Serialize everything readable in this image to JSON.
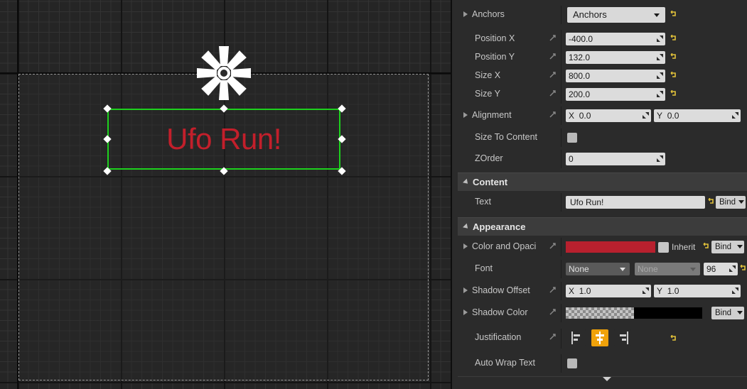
{
  "canvas": {
    "widget_text": "Ufo Run!",
    "widget_text_color": "#c31f2b",
    "selection_color": "#1dd11d"
  },
  "details": {
    "anchors": {
      "label": "Anchors",
      "value": "Anchors"
    },
    "position_x": {
      "label": "Position X",
      "value": "-400.0"
    },
    "position_y": {
      "label": "Position Y",
      "value": "132.0"
    },
    "size_x": {
      "label": "Size X",
      "value": "800.0"
    },
    "size_y": {
      "label": "Size Y",
      "value": "200.0"
    },
    "alignment": {
      "label": "Alignment",
      "x_label": "X",
      "x_value": "0.0",
      "y_label": "Y",
      "y_value": "0.0"
    },
    "size_to_content": {
      "label": "Size To Content"
    },
    "zorder": {
      "label": "ZOrder",
      "value": "0"
    },
    "content_section": {
      "title": "Content"
    },
    "text": {
      "label": "Text",
      "value": "Ufo Run!",
      "bind_label": "Bind"
    },
    "appearance_section": {
      "title": "Appearance"
    },
    "color_opacity": {
      "label": "Color and Opaci",
      "inherit_label": "Inherit",
      "bind_label": "Bind",
      "color": "#b8202e"
    },
    "font": {
      "label": "Font",
      "family": "None",
      "typeface": "None",
      "size": "96"
    },
    "shadow_offset": {
      "label": "Shadow Offset",
      "x_label": "X",
      "x_value": "1.0",
      "y_label": "Y",
      "y_value": "1.0"
    },
    "shadow_color": {
      "label": "Shadow Color",
      "bind_label": "Bind"
    },
    "justification": {
      "label": "Justification",
      "options": [
        "left-align-icon",
        "center-align-icon",
        "right-align-icon"
      ],
      "selected": "center"
    },
    "auto_wrap": {
      "label": "Auto Wrap Text"
    }
  }
}
